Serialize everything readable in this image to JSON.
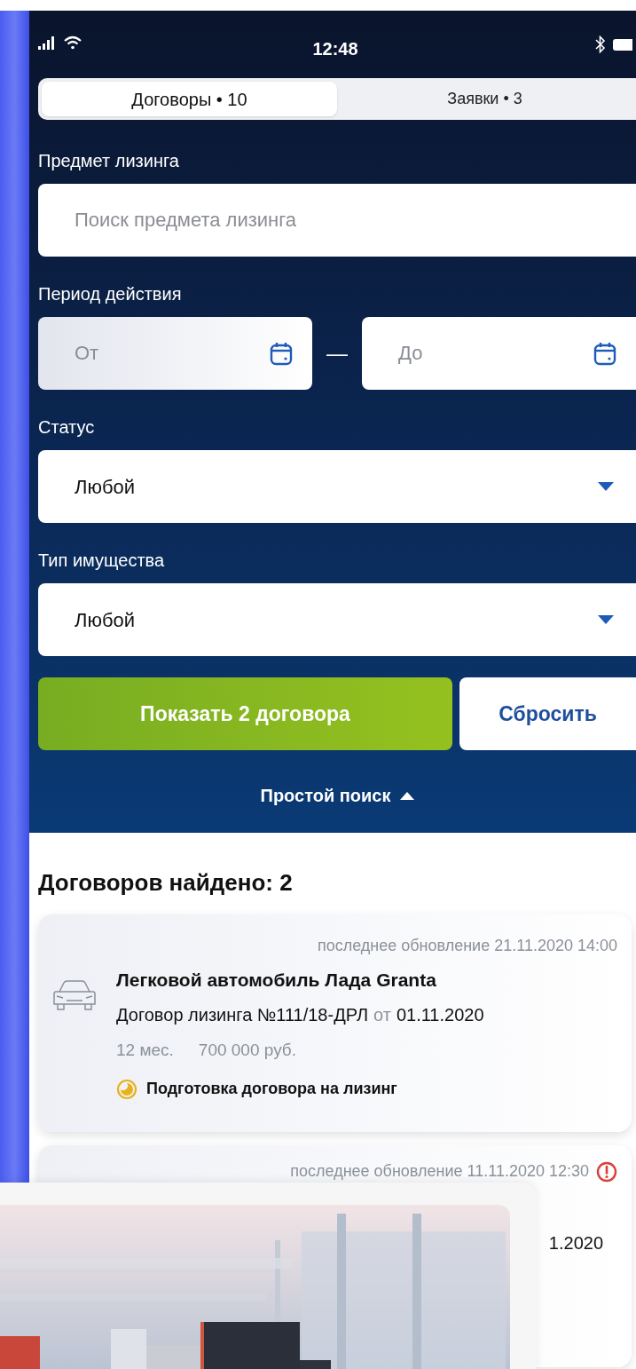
{
  "status_bar": {
    "time": "12:48"
  },
  "tabs": [
    {
      "label": "Договоры • 10",
      "selected": true
    },
    {
      "label": "Заявки • 3",
      "selected": false
    }
  ],
  "filters": {
    "subject": {
      "label": "Предмет лизинга",
      "placeholder": "Поиск предмета лизинга"
    },
    "period": {
      "label": "Период действия",
      "from": {
        "placeholder": "От"
      },
      "separator": "—",
      "to": {
        "placeholder": "До"
      }
    },
    "status": {
      "label": "Статус",
      "value": "Любой"
    },
    "property_type": {
      "label": "Тип имущества",
      "value": "Любой"
    },
    "buttons": {
      "primary": "Показать 2 договора",
      "reset": "Сбросить"
    },
    "simple_search": {
      "label": "Простой поиск",
      "expanded": true
    }
  },
  "results": {
    "title": "Договоров найдено: 2",
    "cards": [
      {
        "updated": "последнее обновление 21.11.2020 14:00",
        "title": "Легковой автомобиль Лада Granta",
        "contract": "Договор лизинга №111/18-ДРЛ",
        "date_prefix": "от",
        "date": "01.11.2020",
        "term": "12 мес.",
        "amount": "700 000 руб.",
        "status": "Подготовка договора на лизинг"
      },
      {
        "updated": "последнее обновление 11.11.2020 12:30",
        "alert": true,
        "date": "1.2020"
      }
    ]
  }
}
